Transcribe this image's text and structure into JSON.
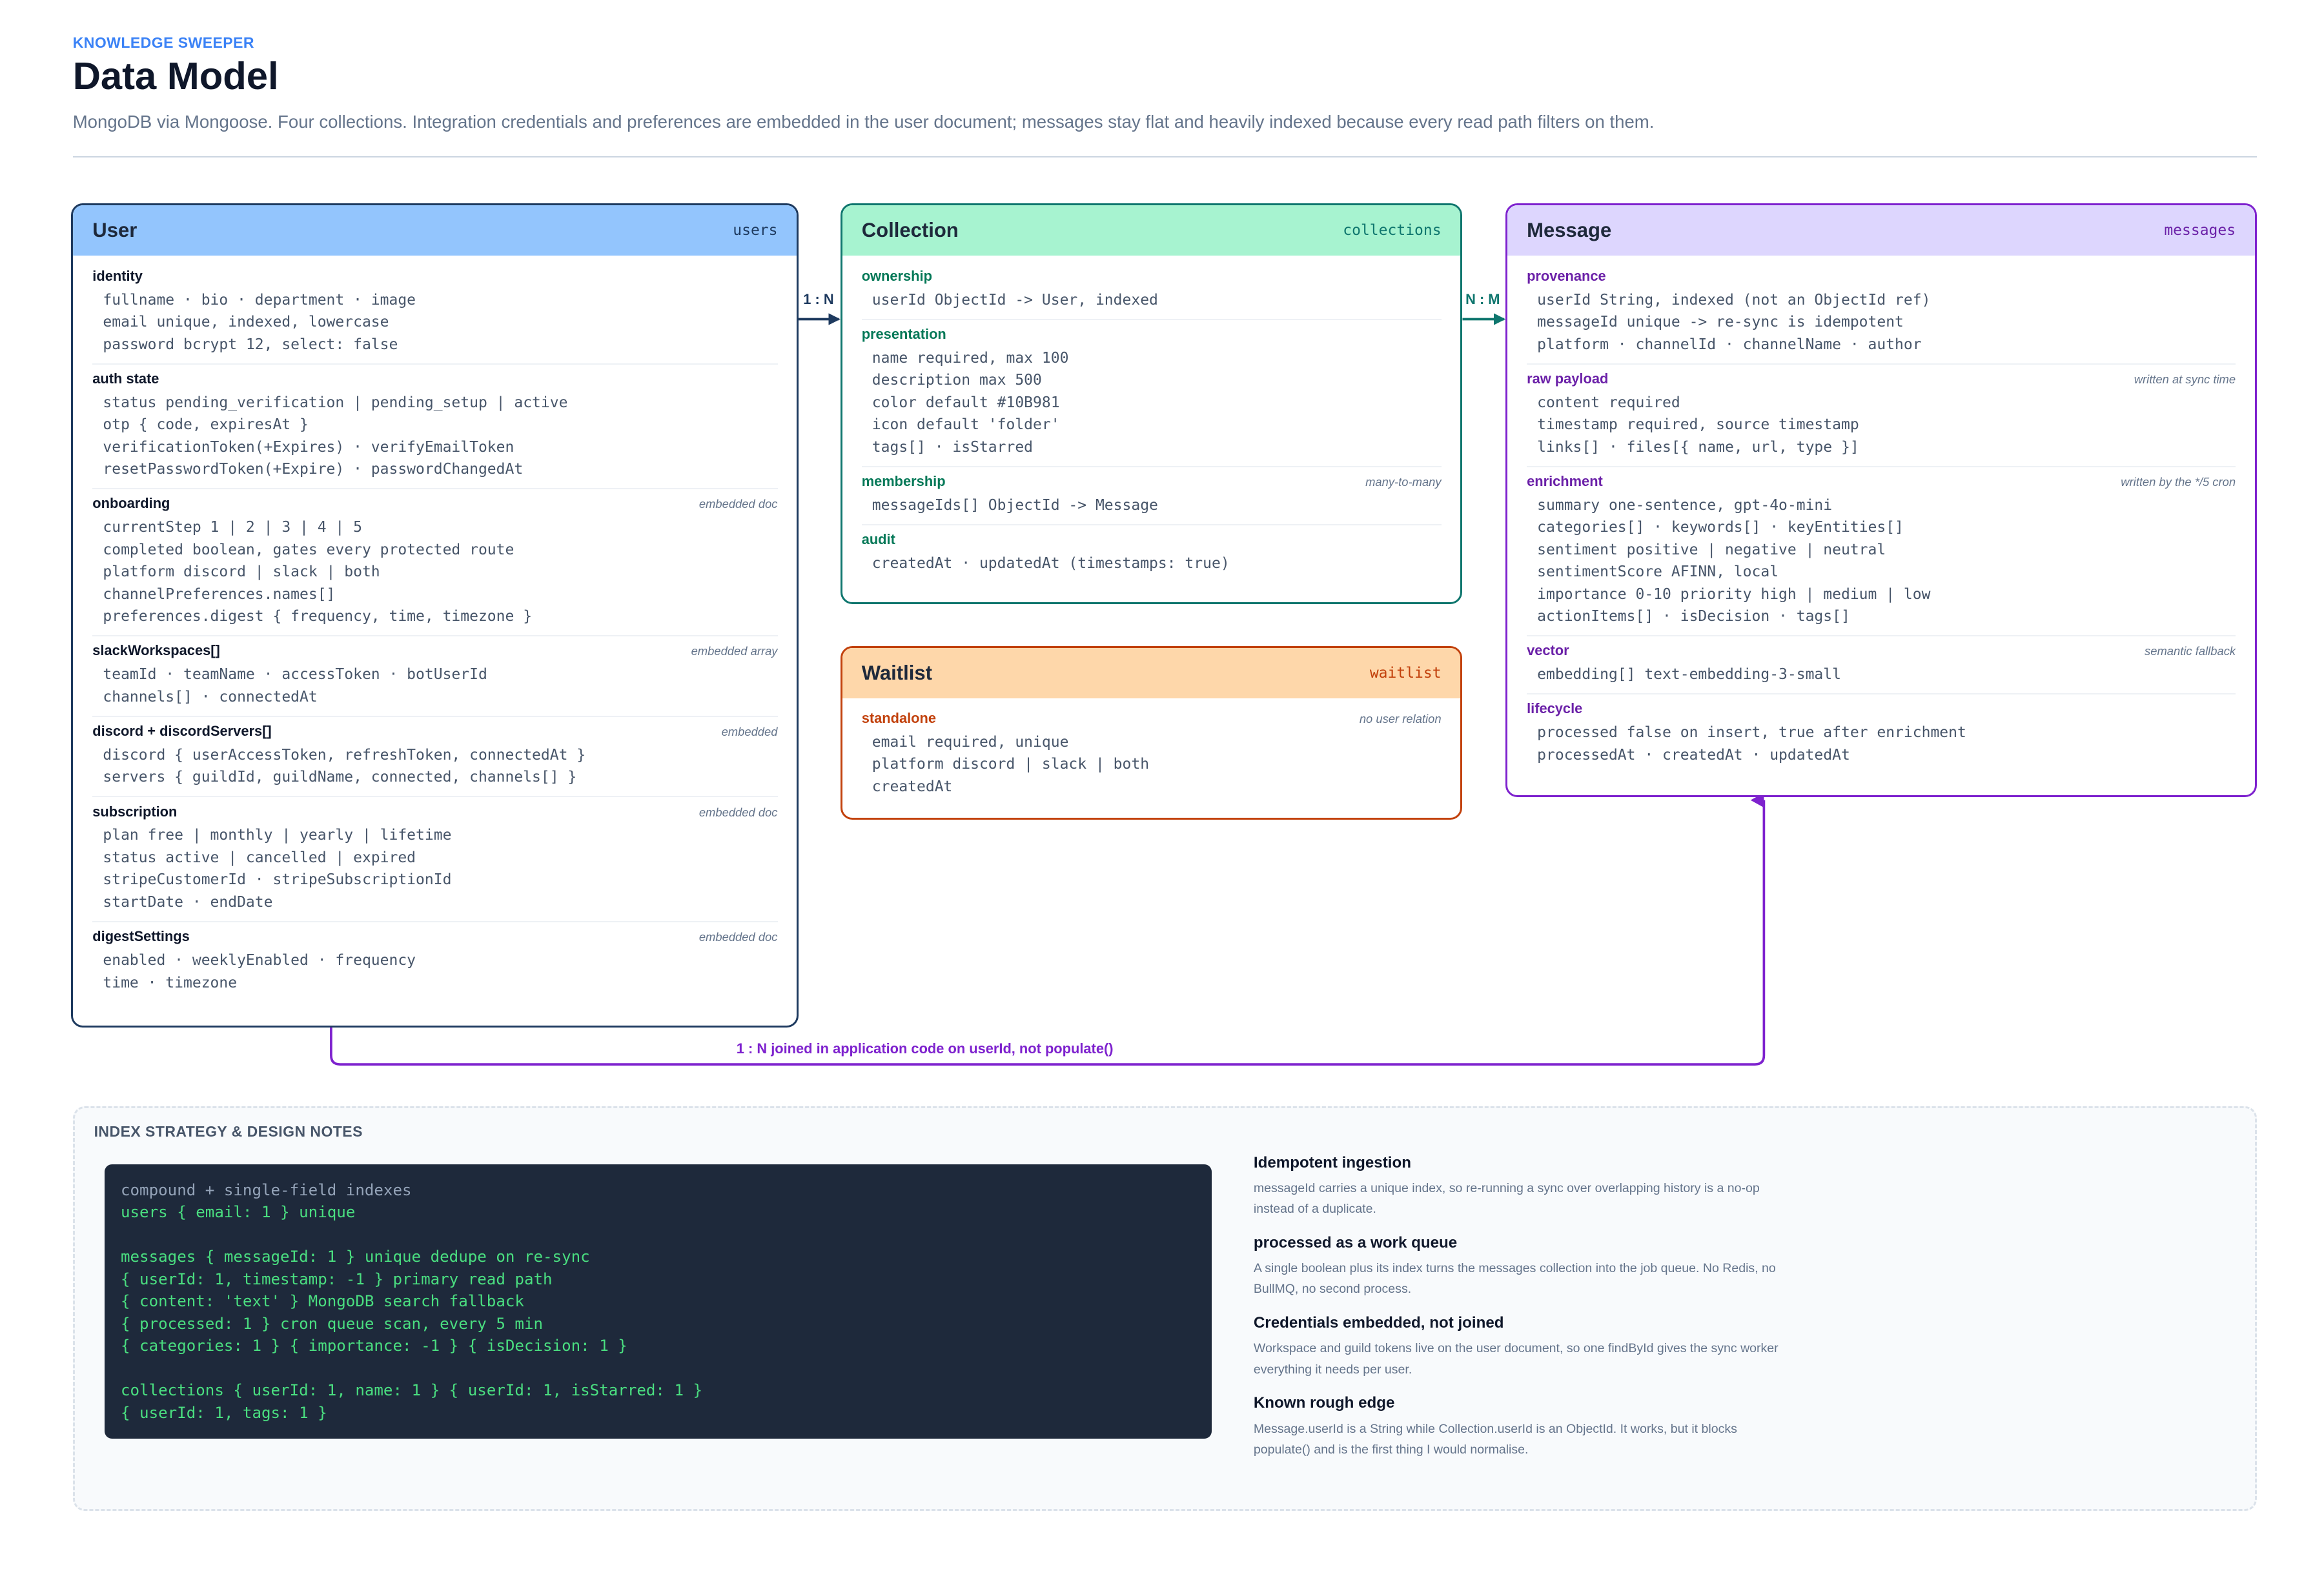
{
  "header": {
    "eyebrow": "KNOWLEDGE SWEEPER",
    "title": "Data Model",
    "subtitle": "MongoDB via Mongoose. Four collections. Integration credentials and preferences are embedded in the user document; messages stay flat and heavily indexed because every read path filters on them."
  },
  "colors": {
    "user": "#1e3a5f",
    "collection": "#0f766e",
    "waitlist": "#c2410c",
    "message": "#7e22ce",
    "accent": "#3b82f6"
  },
  "entities": {
    "user": {
      "name": "User",
      "collection": "users",
      "sections": [
        {
          "title": "identity",
          "note": "",
          "lines": [
            "fullname · bio · department · image",
            "email unique, indexed, lowercase",
            "password bcrypt 12, select: false"
          ]
        },
        {
          "title": "auth state",
          "note": "",
          "lines": [
            "status pending_verification | pending_setup | active",
            "otp { code, expiresAt }",
            "verificationToken(+Expires) · verifyEmailToken",
            "resetPasswordToken(+Expire) · passwordChangedAt"
          ]
        },
        {
          "title": "onboarding",
          "note": "embedded doc",
          "lines": [
            "currentStep 1 | 2 | 3 | 4 | 5",
            "completed boolean, gates every protected route",
            "platform discord | slack | both",
            "channelPreferences.names[]",
            "preferences.digest { frequency, time, timezone }"
          ]
        },
        {
          "title": "slackWorkspaces[]",
          "note": "embedded array",
          "lines": [
            "teamId · teamName · accessToken · botUserId",
            "channels[] · connectedAt"
          ]
        },
        {
          "title": "discord + discordServers[]",
          "note": "embedded",
          "lines": [
            "discord { userAccessToken, refreshToken, connectedAt }",
            "servers { guildId, guildName, connected, channels[] }"
          ]
        },
        {
          "title": "subscription",
          "note": "embedded doc",
          "lines": [
            "plan free | monthly | yearly | lifetime",
            "status active | cancelled | expired",
            "stripeCustomerId · stripeSubscriptionId",
            "startDate · endDate"
          ]
        },
        {
          "title": "digestSettings",
          "note": "embedded doc",
          "lines": [
            "enabled · weeklyEnabled · frequency",
            "time · timezone"
          ]
        }
      ]
    },
    "collection": {
      "name": "Collection",
      "collection": "collections",
      "sections": [
        {
          "title": "ownership",
          "note": "",
          "lines": [
            "userId ObjectId -> User, indexed"
          ]
        },
        {
          "title": "presentation",
          "note": "",
          "lines": [
            "name required, max 100",
            "description max 500",
            "color default #10B981",
            "icon default 'folder'",
            "tags[] · isStarred"
          ]
        },
        {
          "title": "membership",
          "note": "many-to-many",
          "lines": [
            "messageIds[] ObjectId -> Message"
          ]
        },
        {
          "title": "audit",
          "note": "",
          "lines": [
            "createdAt · updatedAt (timestamps: true)"
          ]
        }
      ]
    },
    "waitlist": {
      "name": "Waitlist",
      "collection": "waitlist",
      "sections": [
        {
          "title": "standalone",
          "note": "no user relation",
          "lines": [
            "email required, unique",
            "platform discord | slack | both",
            "createdAt"
          ]
        }
      ]
    },
    "message": {
      "name": "Message",
      "collection": "messages",
      "sections": [
        {
          "title": "provenance",
          "note": "",
          "lines": [
            "userId String, indexed (not an ObjectId ref)",
            "messageId unique -> re-sync is idempotent",
            "platform · channelId · channelName · author"
          ]
        },
        {
          "title": "raw payload",
          "note": "written at sync time",
          "lines": [
            "content required",
            "timestamp required, source timestamp",
            "links[] · files[{ name, url, type }]"
          ]
        },
        {
          "title": "enrichment",
          "note": "written by the */5 cron",
          "lines": [
            "summary one-sentence, gpt-4o-mini",
            "categories[] · keywords[] · keyEntities[]",
            "sentiment positive | negative | neutral",
            "sentimentScore AFINN, local",
            "importance 0-10 priority high | medium | low",
            "actionItems[] · isDecision · tags[]"
          ]
        },
        {
          "title": "vector",
          "note": "semantic fallback",
          "lines": [
            "embedding[] text-embedding-3-small"
          ]
        },
        {
          "title": "lifecycle",
          "note": "",
          "lines": [
            "processed false on insert, true after enrichment",
            "processedAt · createdAt · updatedAt"
          ]
        }
      ]
    }
  },
  "relations": {
    "user_collection": "1 : N",
    "collection_message": "N : M",
    "user_message": "1 : N joined in application code on userId, not populate()"
  },
  "notes": {
    "heading": "INDEX STRATEGY & DESIGN NOTES",
    "code": [
      "compound + single-field indexes",
      "users { email: 1 } unique",
      "",
      "messages { messageId: 1 } unique dedupe on re-sync",
      "{ userId: 1, timestamp: -1 } primary read path",
      "{ content: 'text' } MongoDB search fallback",
      "{ processed: 1 } cron queue scan, every 5 min",
      "{ categories: 1 } { importance: -1 } { isDecision: 1 }",
      "",
      "collections { userId: 1, name: 1 } { userId: 1, isStarred: 1 }",
      "{ userId: 1, tags: 1 }"
    ],
    "items": [
      {
        "title": "Idempotent ingestion",
        "text": "messageId carries a unique index, so re-running a sync over overlapping history is a no-op instead of a duplicate."
      },
      {
        "title": "processed as a work queue",
        "text": "A single boolean plus its index turns the messages collection into the job queue. No Redis, no BullMQ, no second process."
      },
      {
        "title": "Credentials embedded, not joined",
        "text": "Workspace and guild tokens live on the user document, so one findById gives the sync worker everything it needs per user."
      },
      {
        "title": "Known rough edge",
        "text": "Message.userId is a String while Collection.userId is an ObjectId. It works, but it blocks populate() and is the first thing I would normalise."
      }
    ]
  }
}
